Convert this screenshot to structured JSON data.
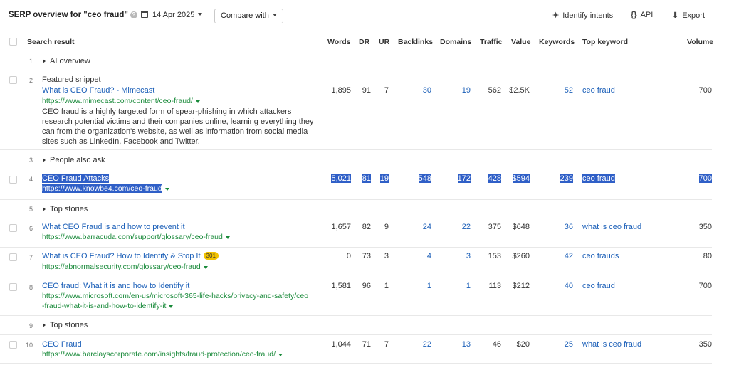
{
  "header": {
    "title": "SERP overview for \"ceo fraud\"",
    "date": "14 Apr 2025",
    "compare_label": "Compare with",
    "identify_label": "Identify intents",
    "api_label": "API",
    "export_label": "Export"
  },
  "columns": {
    "search_result": "Search result",
    "words": "Words",
    "dr": "DR",
    "ur": "UR",
    "backlinks": "Backlinks",
    "domains": "Domains",
    "traffic": "Traffic",
    "value": "Value",
    "keywords": "Keywords",
    "top_keyword": "Top keyword",
    "volume": "Volume"
  },
  "rows": [
    {
      "pos": "1",
      "label": "AI overview"
    },
    {
      "pos": "2",
      "label": "Featured snippet",
      "title": "What is CEO Fraud? - Mimecast",
      "url": "https://www.mimecast.com/content/ceo-fraud/",
      "snippet": "CEO fraud is a highly targeted form of spear-phishing in which attackers research potential victims and their companies online, learning everything they can from the organization's website, as well as information from social media sites such as LinkedIn, Facebook and Twitter.",
      "words": "1,895",
      "dr": "91",
      "ur": "7",
      "backlinks": "30",
      "domains": "19",
      "traffic": "562",
      "value": "$2.5K",
      "keywords": "52",
      "top_keyword": "ceo fraud",
      "volume": "700"
    },
    {
      "pos": "3",
      "label": "People also ask"
    },
    {
      "pos": "4",
      "title": "CEO Fraud Attacks",
      "url": "https://www.knowbe4.com/ceo-fraud",
      "words": "5,021",
      "dr": "81",
      "ur": "19",
      "backlinks": "548",
      "domains": "172",
      "traffic": "428",
      "value": "$594",
      "keywords": "239",
      "top_keyword": "ceo fraud",
      "volume": "700"
    },
    {
      "pos": "5",
      "label": "Top stories"
    },
    {
      "pos": "6",
      "title": "What CEO Fraud is and how to prevent it",
      "url": "https://www.barracuda.com/support/glossary/ceo-fraud",
      "words": "1,657",
      "dr": "82",
      "ur": "9",
      "backlinks": "24",
      "domains": "22",
      "traffic": "375",
      "value": "$648",
      "keywords": "36",
      "top_keyword": "what is ceo fraud",
      "volume": "350"
    },
    {
      "pos": "7",
      "title": "What is CEO Fraud? How to Identify & Stop It",
      "badge": "301",
      "url": "https://abnormalsecurity.com/glossary/ceo-fraud",
      "words": "0",
      "dr": "73",
      "ur": "3",
      "backlinks": "4",
      "domains": "3",
      "traffic": "153",
      "value": "$260",
      "keywords": "42",
      "top_keyword": "ceo frauds",
      "volume": "80"
    },
    {
      "pos": "8",
      "title": "CEO fraud: What it is and how to Identify it",
      "url_line1": "https://www.microsoft.com/en-us/microsoft-365-life-hacks/privacy-and-safety/ceo",
      "url_line2": "-fraud-what-it-is-and-how-to-identify-it",
      "words": "1,581",
      "dr": "96",
      "ur": "1",
      "backlinks": "1",
      "domains": "1",
      "traffic": "113",
      "value": "$212",
      "keywords": "40",
      "top_keyword": "ceo fraud",
      "volume": "700"
    },
    {
      "pos": "9",
      "label": "Top stories"
    },
    {
      "pos": "10",
      "title": "CEO Fraud",
      "url": "https://www.barclayscorporate.com/insights/fraud-protection/ceo-fraud/",
      "words": "1,044",
      "dr": "71",
      "ur": "7",
      "backlinks": "22",
      "domains": "13",
      "traffic": "46",
      "value": "$20",
      "keywords": "25",
      "top_keyword": "what is ceo fraud",
      "volume": "350"
    }
  ],
  "icons": {
    "calendar": "calendar-icon",
    "identify": "sparkle-icon",
    "api": "braces-icon",
    "export": "download-icon",
    "help": "help-icon"
  },
  "colors": {
    "link": "#1b5fb8",
    "url": "#198a3a",
    "selection": "#2f5fc7",
    "badge": "#f2c200"
  }
}
